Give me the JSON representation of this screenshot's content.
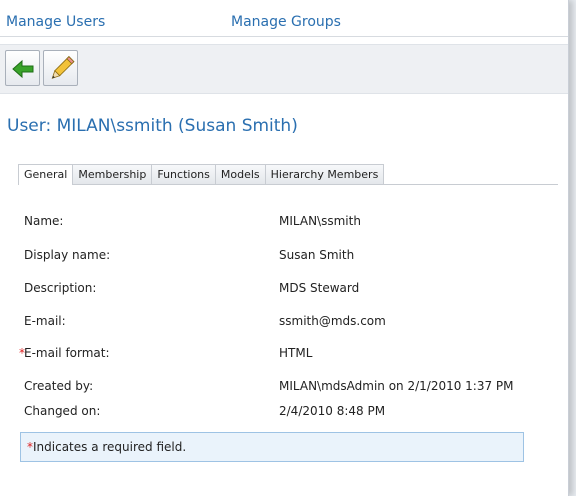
{
  "nav": {
    "manage_users": "Manage Users",
    "manage_groups": "Manage Groups"
  },
  "toolbar": {
    "back_icon": "green-back-arrow-icon",
    "edit_icon": "pencil-edit-icon"
  },
  "page": {
    "title": "User: MILAN\\ssmith (Susan Smith)"
  },
  "tabs": [
    {
      "label": "General",
      "active": true
    },
    {
      "label": "Membership",
      "active": false
    },
    {
      "label": "Functions",
      "active": false
    },
    {
      "label": "Models",
      "active": false
    },
    {
      "label": "Hierarchy Members",
      "active": false
    }
  ],
  "fields": [
    {
      "label": "Name:",
      "value": "MILAN\\ssmith",
      "required": false
    },
    {
      "label": "Display name:",
      "value": "Susan Smith",
      "required": false
    },
    {
      "label": "Description:",
      "value": "MDS Steward",
      "required": false
    },
    {
      "label": "E-mail:",
      "value": "ssmith@mds.com",
      "required": false
    },
    {
      "label": "E-mail format:",
      "value": "HTML",
      "required": true
    },
    {
      "label": "Created by:",
      "value": "MILAN\\mdsAdmin on 2/1/2010 1:37 PM",
      "required": false
    },
    {
      "label": "Changed on:",
      "value": "2/4/2010 8:48 PM",
      "required": false
    }
  ],
  "required_note": {
    "star": "*",
    "text": "Indicates a required field."
  },
  "colors": {
    "link": "#2a6fb0",
    "required": "#d22222",
    "note_bg": "#eaf3fb"
  }
}
